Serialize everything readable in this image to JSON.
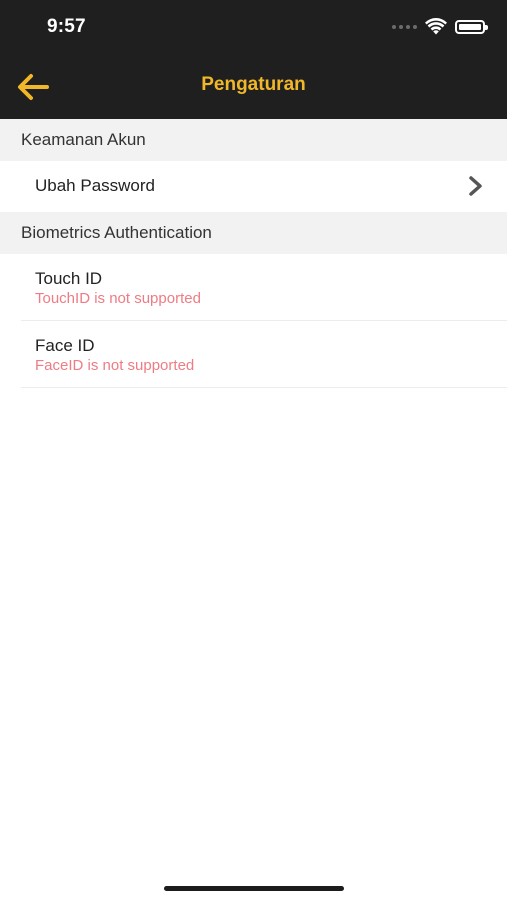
{
  "status_bar": {
    "time": "9:57"
  },
  "header": {
    "title": "Pengaturan",
    "back_icon": "arrow-left-icon",
    "accent_color": "#f0b829"
  },
  "sections": [
    {
      "header": "Keamanan Akun",
      "items": [
        {
          "title": "Ubah Password",
          "icon": "chevron-right-icon"
        }
      ]
    },
    {
      "header": "Biometrics Authentication",
      "items": [
        {
          "title": "Touch ID",
          "subtitle": "TouchID is not supported"
        },
        {
          "title": "Face ID",
          "subtitle": "FaceID is not supported"
        }
      ]
    }
  ],
  "colors": {
    "header_bg": "#1f1f1f",
    "section_bg": "#f2f2f2",
    "error_text": "#ee7c84"
  }
}
